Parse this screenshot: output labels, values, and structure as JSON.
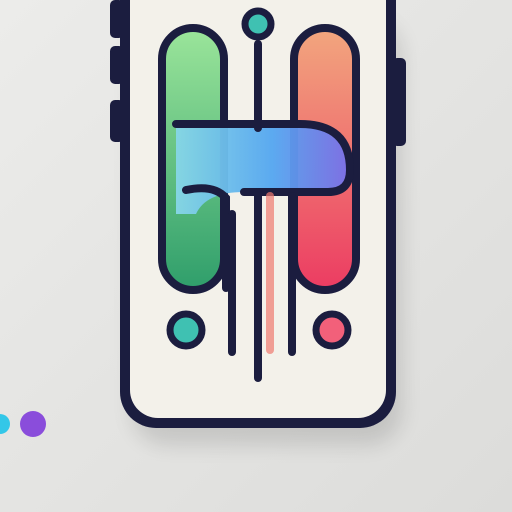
{
  "colors": {
    "background": "#e4e4e2",
    "phone_body": "#f3f1ea",
    "outline": "#1b1d3f",
    "green_start": "#8fe08f",
    "green_end": "#36a86e",
    "red_start": "#f0a07a",
    "red_end": "#ee3f63",
    "blue_start": "#7fd2e8",
    "blue_end": "#6f78ea",
    "dot_teal": "#3fc1b2",
    "dot_coral": "#f2607a",
    "dot_cyan": "#33c7e8",
    "dot_purple": "#8a4ddb"
  },
  "icons": {
    "phone": "smartphone-icon",
    "logo": "abstract-h-logo-icon",
    "decor": "dot-icon"
  }
}
